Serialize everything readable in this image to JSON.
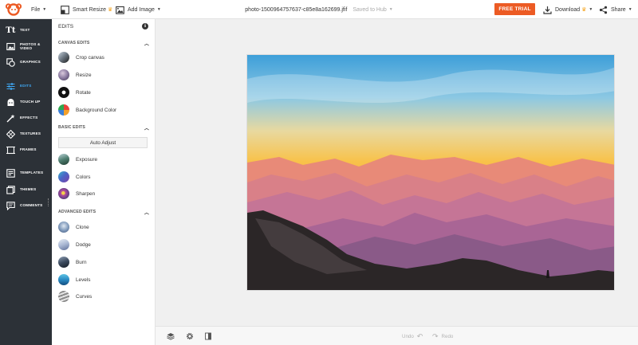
{
  "topbar": {
    "file_menu": "File",
    "smart_resize": "Smart Resize",
    "add_image": "Add Image",
    "filename": "photo-1500964757637-c85e8a162699.jfif",
    "saved_status": "Saved to Hub",
    "free_trial": "FREE TRIAL",
    "download": "Download",
    "share": "Share"
  },
  "leftnav": {
    "items": [
      {
        "label": "TEXT",
        "icon": "text-icon"
      },
      {
        "label": "PHOTOS & VIDEO",
        "icon": "photos-icon"
      },
      {
        "label": "GRAPHICS",
        "icon": "graphics-icon"
      },
      {
        "label": "EDITS",
        "icon": "edits-icon"
      },
      {
        "label": "TOUCH UP",
        "icon": "touch-up-icon"
      },
      {
        "label": "EFFECTS",
        "icon": "effects-icon"
      },
      {
        "label": "TEXTURES",
        "icon": "textures-icon"
      },
      {
        "label": "FRAMES",
        "icon": "frames-icon"
      },
      {
        "label": "TEMPLATES",
        "icon": "templates-icon"
      },
      {
        "label": "THEMES",
        "icon": "themes-icon"
      },
      {
        "label": "COMMENTS",
        "icon": "comments-icon"
      }
    ],
    "active": "EDITS",
    "active_color": "#3fa9f5"
  },
  "panel": {
    "title": "EDITS",
    "sections": {
      "canvas": "CANVAS EDITS",
      "basic": "BASIC EDITS",
      "advanced": "ADVANCED EDITS"
    },
    "canvas_items": [
      "Crop canvas",
      "Resize",
      "Rotate",
      "Background Color"
    ],
    "auto_adjust": "Auto Adjust",
    "basic_items": [
      "Exposure",
      "Colors",
      "Sharpen"
    ],
    "advanced_items": [
      "Clone",
      "Dodge",
      "Burn",
      "Levels",
      "Curves"
    ]
  },
  "bottombar": {
    "undo": "Undo",
    "redo": "Redo"
  },
  "colors": {
    "brand": "#ec5b24",
    "nav_bg": "#2c3137",
    "accent": "#3fa9f5"
  }
}
